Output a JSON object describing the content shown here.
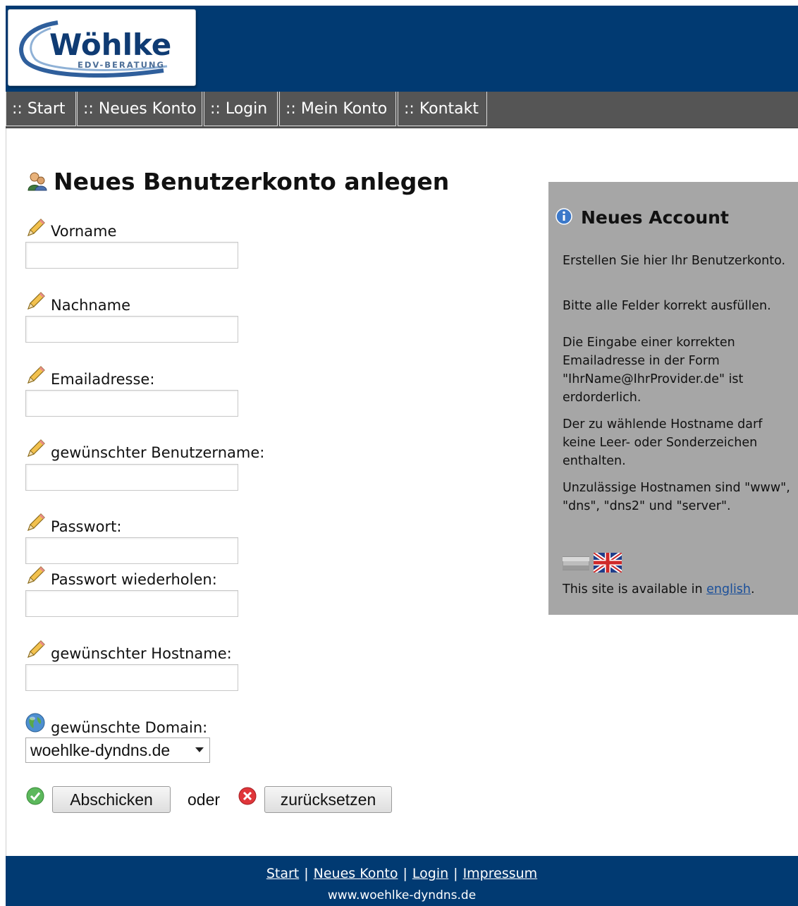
{
  "logo": {
    "name": "Wöhlke",
    "tagline": "EDV-BERATUNG"
  },
  "nav": [
    {
      "label": ":: Start"
    },
    {
      "label": ":: Neues Konto"
    },
    {
      "label": ":: Login"
    },
    {
      "label": ":: Mein Konto"
    },
    {
      "label": ":: Kontakt"
    }
  ],
  "main": {
    "title": "Neues Benutzerkonto anlegen",
    "fields": [
      {
        "label": "Vorname",
        "value": ""
      },
      {
        "label": "Nachname",
        "value": ""
      },
      {
        "label": "Emailadresse:",
        "value": ""
      },
      {
        "label": "gewünschter Benutzername:",
        "value": ""
      },
      {
        "label": "Passwort:",
        "value": ""
      },
      {
        "label": "Passwort wiederholen:",
        "value": ""
      },
      {
        "label": "gewünschter Hostname:",
        "value": ""
      }
    ],
    "domain": {
      "label": "gewünschte Domain:",
      "selected": "woehlke-dyndns.de"
    },
    "submit_label": "Abschicken",
    "or_text": "oder",
    "reset_label": "zurücksetzen"
  },
  "sidebar": {
    "title": "Neues Account",
    "p1": "Erstellen Sie hier Ihr Benutzerkonto.",
    "p2": "Bitte alle Felder korrekt ausfüllen.",
    "p3": "Die Eingabe einer korrekten Emailadresse in der Form \"IhrName@IhrProvider.de\" ist erdorderlich.",
    "p4": "Der zu wählende Hostname darf keine Leer- oder Sonderzeichen enthalten.",
    "p5": "Unzulässige Hostnamen sind \"www\", \"dns\", \"dns2\" und \"server\".",
    "lang_prefix": "This site is available in ",
    "lang_link": "english",
    "lang_suffix": "."
  },
  "footer": {
    "links": [
      "Start",
      "Neues Konto",
      "Login",
      "Impressum"
    ],
    "separator": "|",
    "url": "www.woehlke-dyndns.de"
  },
  "colors": {
    "header": "#013a72",
    "nav": "#555555",
    "sidebar": "#a6a6a6"
  },
  "icons": [
    "user-icon",
    "pencil-icon",
    "globe-icon",
    "check-icon",
    "cancel-icon",
    "info-icon",
    "flag-de-icon",
    "flag-uk-icon"
  ]
}
